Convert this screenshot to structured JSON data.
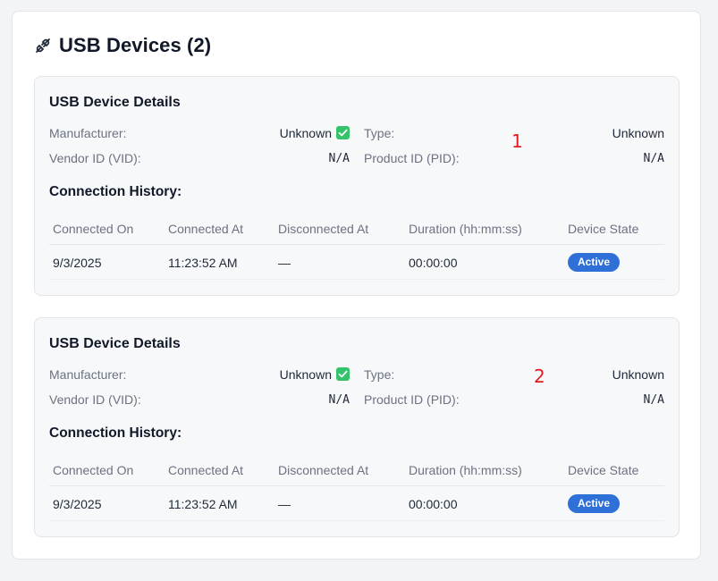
{
  "panel": {
    "title": "USB Devices (2)",
    "icon": "plug-icon"
  },
  "labels": {
    "card_title": "USB Device Details",
    "manufacturer": "Manufacturer:",
    "type": "Type:",
    "vendor_id": "Vendor ID (VID):",
    "product_id": "Product ID (PID):",
    "connection_history": "Connection History:"
  },
  "table_headers": [
    "Connected On",
    "Connected At",
    "Disconnected At",
    "Duration (hh:mm:ss)",
    "Device State"
  ],
  "devices": [
    {
      "marker": "1",
      "manufacturer": "Unknown",
      "type": "Unknown",
      "vendor_id": "N/A",
      "product_id": "N/A",
      "history": [
        {
          "connected_on": "9/3/2025",
          "connected_at": "11:23:52 AM",
          "disconnected_at": "—",
          "duration": "00:00:00",
          "state": "Active"
        }
      ]
    },
    {
      "marker": "2",
      "manufacturer": "Unknown",
      "type": "Unknown",
      "vendor_id": "N/A",
      "product_id": "N/A",
      "history": [
        {
          "connected_on": "9/3/2025",
          "connected_at": "11:23:52 AM",
          "disconnected_at": "—",
          "duration": "00:00:00",
          "state": "Active"
        }
      ]
    }
  ],
  "colors": {
    "badge_active": "#2f6fd8",
    "check_icon": "#34c26b",
    "marker": "#e11d21"
  }
}
